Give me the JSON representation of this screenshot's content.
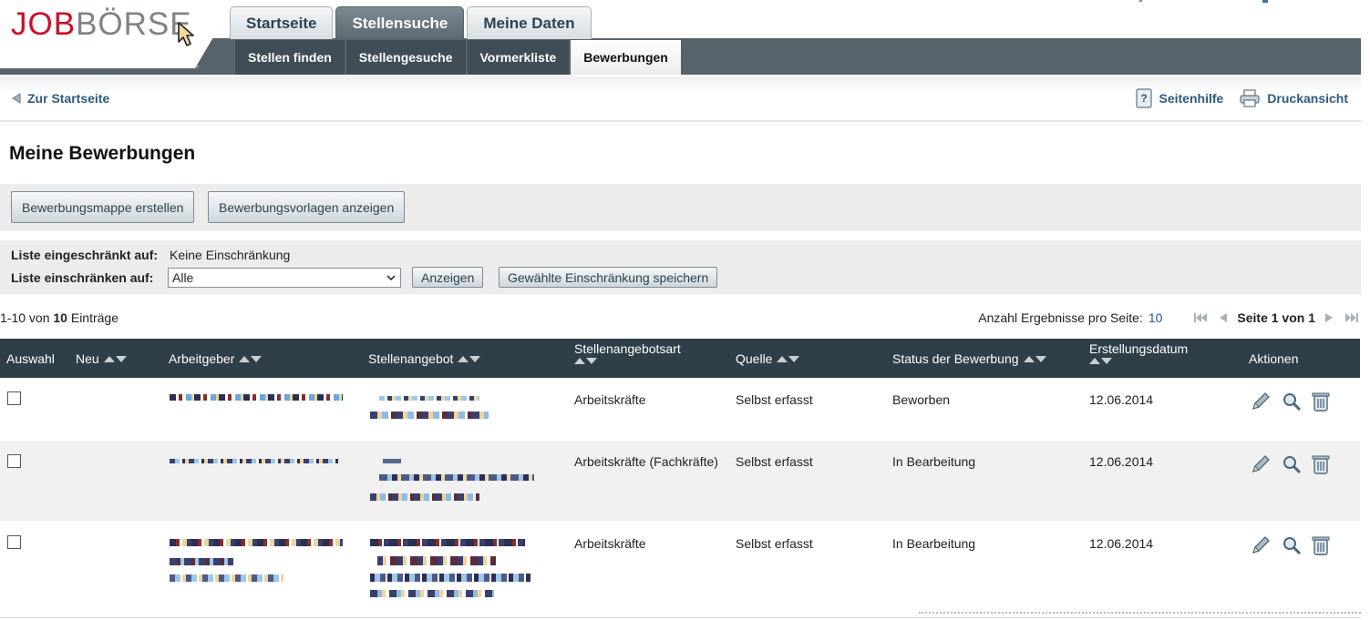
{
  "logo": {
    "part1": "JOB",
    "part2": "BÖRSE"
  },
  "tabs": [
    {
      "label": "Startseite"
    },
    {
      "label": "Stellensuche"
    },
    {
      "label": "Meine Daten"
    }
  ],
  "subnav": [
    {
      "label": "Stellen finden"
    },
    {
      "label": "Stellengesuche"
    },
    {
      "label": "Vormerkliste"
    },
    {
      "label": "Bewerbungen"
    }
  ],
  "toolbar": {
    "back_label": "Zur Startseite",
    "help_label": "Seitenhilfe",
    "print_label": "Druckansicht"
  },
  "page_title": "Meine Bewerbungen",
  "actions": {
    "create_folder_label": "Bewerbungsmappe erstellen",
    "show_templates_label": "Bewerbungsvorlagen anzeigen"
  },
  "filter": {
    "restricted_label": "Liste eingeschränkt auf:",
    "restricted_value": "Keine Einschränkung",
    "restrict_label": "Liste einschränken auf:",
    "select_value": "Alle",
    "show_button": "Anzeigen",
    "save_button": "Gewählte Einschränkung speichern"
  },
  "pagination": {
    "range": "1-10",
    "von_word": "von",
    "total": "10",
    "entries_word": "Einträge",
    "per_page_label": "Anzahl Ergebnisse pro Seite:",
    "per_page_value": "10",
    "page_text": "Seite 1 von 1"
  },
  "columns": {
    "select": "Auswahl",
    "new": "Neu",
    "employer": "Arbeitgeber",
    "offer": "Stellenangebot",
    "offer_type": "Stellenangebotsart",
    "source": "Quelle",
    "status": "Status der Bewerbung",
    "created": "Erstellungsdatum",
    "actions": "Aktionen"
  },
  "rows": [
    {
      "offer_type": "Arbeitskräfte",
      "source": "Selbst erfasst",
      "status": "Beworben",
      "created": "12.06.2014"
    },
    {
      "offer_type": "Arbeitskräfte (Fachkräfte)",
      "source": "Selbst erfasst",
      "status": "In Bearbeitung",
      "created": "12.06.2014"
    },
    {
      "offer_type": "Arbeitskräfte",
      "source": "Selbst erfasst",
      "status": "In Bearbeitung",
      "created": "12.06.2014"
    }
  ],
  "colors": {
    "brand_red": "#c8102e",
    "nav_dark": "#56636b",
    "table_header": "#2e3f4a",
    "link_blue": "#2c5a82"
  }
}
